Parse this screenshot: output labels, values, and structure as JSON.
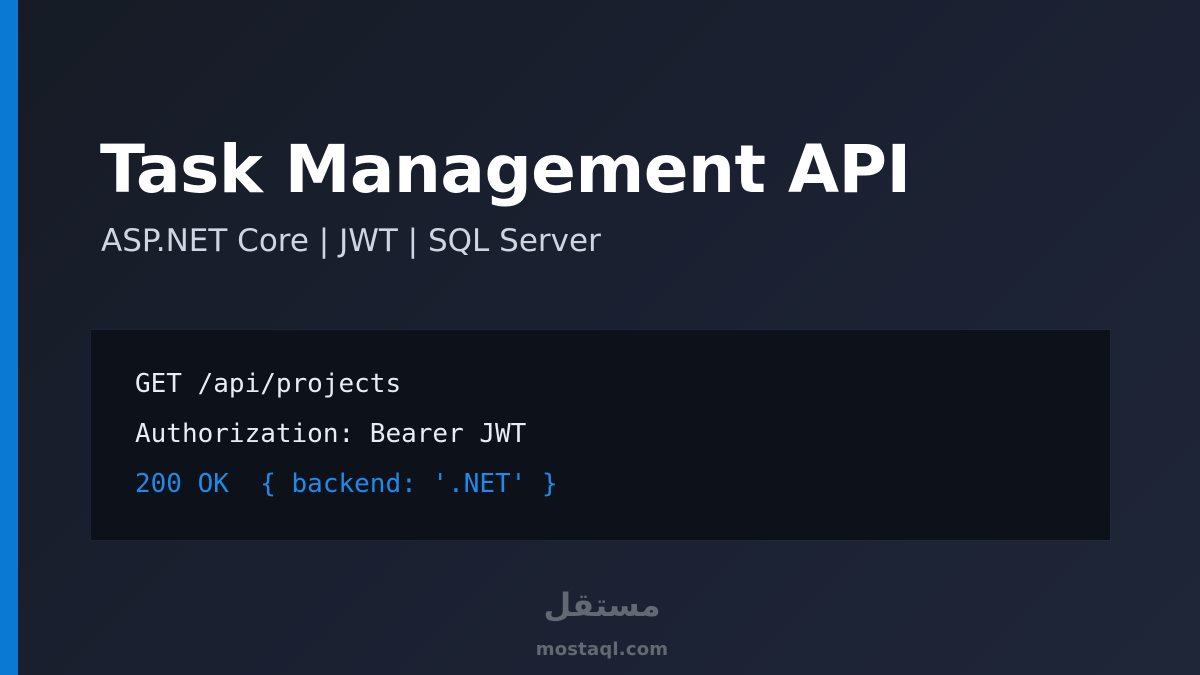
{
  "header": {
    "title": "Task Management API",
    "subtitle": "ASP.NET Core | JWT | SQL Server"
  },
  "code_panel": {
    "lines": [
      "GET /api/projects",
      "Authorization: Bearer JWT",
      "200 OK  { backend: '.NET' }"
    ]
  },
  "watermark": {
    "logo": "مستقل",
    "domain": "mostaql.com"
  },
  "colors": {
    "background": "#1a2030",
    "accent": "#0a79d4",
    "title": "#ffffff",
    "subtitle": "#cfd6e2",
    "code_text": "#e9edf3",
    "code_response": "#1f8ae8",
    "code_panel": "#0d111a",
    "watermark": "#666d77"
  }
}
